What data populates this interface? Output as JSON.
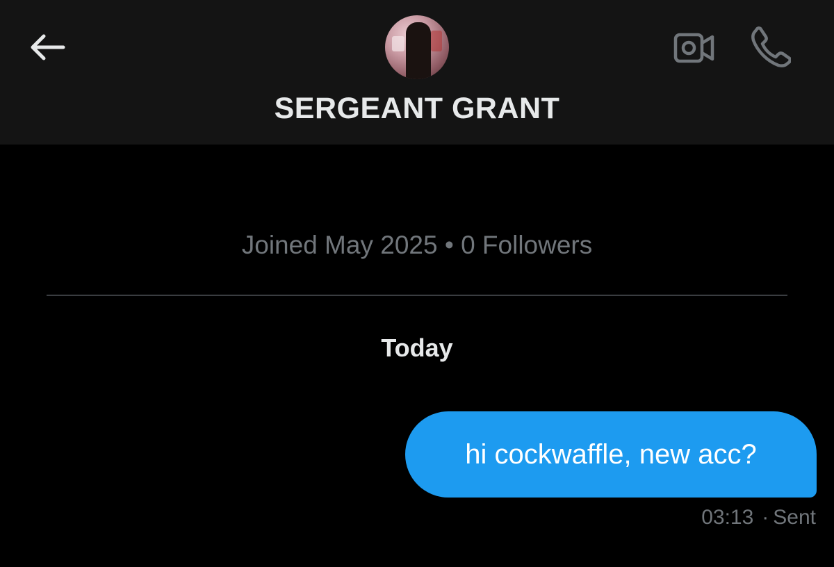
{
  "header": {
    "contact_name": "SERGEANT GRANT",
    "back_icon": "arrow-left-icon",
    "video_icon": "video-camera-icon",
    "call_icon": "phone-icon"
  },
  "profile": {
    "meta": "Joined May 2025 • 0 Followers"
  },
  "conversation": {
    "date_label": "Today",
    "messages": [
      {
        "text": "hi cockwaffle, new acc?",
        "time": "03:13",
        "status": "Sent",
        "direction": "outgoing"
      }
    ]
  },
  "colors": {
    "header_bg": "#141414",
    "background": "#000000",
    "bubble": "#1d9bf0",
    "muted_text": "#71767b",
    "primary_text": "#e7e9ea"
  }
}
